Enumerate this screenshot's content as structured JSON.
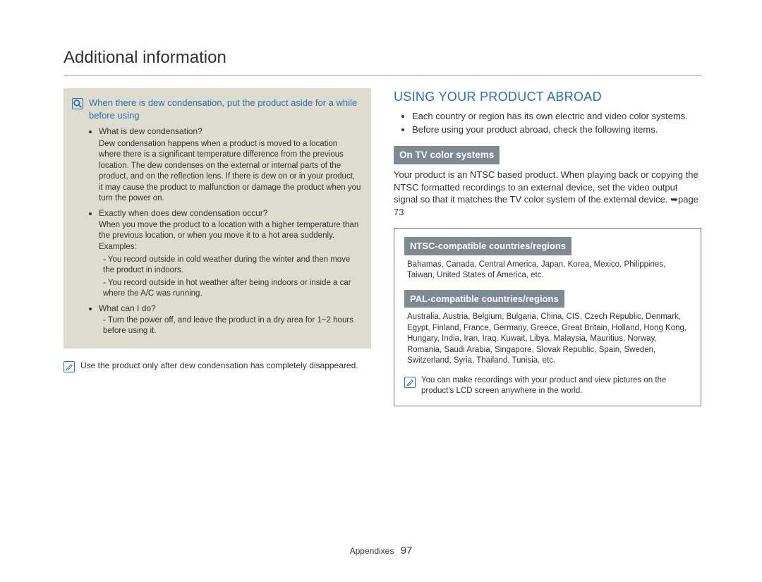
{
  "page_title": "Additional information",
  "footer": {
    "section": "Appendixes",
    "page": "97"
  },
  "left": {
    "info_header": "When there is dew condensation, put the product aside for a while before using",
    "items": [
      {
        "q": "What is dew condensation?",
        "a": "Dew condensation happens when a product is moved to a location where there is a significant temperature difference from the previous location. The dew condenses on the external or internal parts of the product, and on the reflection lens. If there is dew on or in your product, it may cause the product to malfunction or damage the product when you turn the power on."
      },
      {
        "q": "Exactly when does dew condensation occur?",
        "a": "When you move the product to a location with a higher temperature than the previous location, or when you move it to a hot area suddenly. Examples:",
        "sub": [
          "You record outside in cold weather during the winter and then move the product in indoors.",
          "You record outside in hot weather after being indoors or inside a car where the A/C was running."
        ]
      },
      {
        "q": "What can I do?",
        "sub": [
          "Turn the power off, and leave the product in a dry area for 1~2 hours before using it."
        ]
      }
    ],
    "note": "Use the product only after dew condensation has completely disappeared."
  },
  "right": {
    "heading": "USING YOUR PRODUCT ABROAD",
    "bullets": [
      "Each country or region has its own electric and video color systems.",
      "Before using your product abroad, check the following items."
    ],
    "tv_label": "On TV color systems",
    "tv_body": "Your product is an NTSC based product. When playing back or copying the NTSC formatted recordings to an external device, set the video output signal so that it matches the TV color system of the external device. ➥page 73",
    "ntsc_label": "NTSC-compatible countries/regions",
    "ntsc_body": "Bahamas, Canada, Central America, Japan, Korea, Mexico, Philippines, Taiwan, United States of America, etc.",
    "pal_label": "PAL-compatible countries/regions",
    "pal_body": "Australia, Austria, Belgium, Bulgaria, China, CIS, Czech Republic, Denmark, Egypt, Finland, France, Germany, Greece, Great Britain, Holland, Hong Kong, Hungary, India, Iran, Iraq, Kuwait, Libya, Malaysia, Mauritius, Norway, Romania, Saudi Arabia, Singapore, Slovak Republic, Spain, Sweden, Switzerland, Syria, Thailand, Tunisia, etc.",
    "box_note": "You can make recordings with your product and view pictures on the product's LCD screen anywhere in the world."
  }
}
